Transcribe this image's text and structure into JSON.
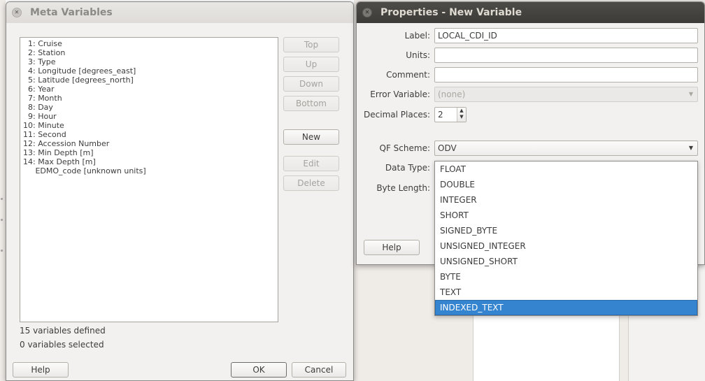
{
  "meta_dialog": {
    "title": "Meta Variables",
    "variables": [
      "  1: Cruise",
      "  2: Station",
      "  3: Type",
      "  4: Longitude [degrees_east]",
      "  5: Latitude [degrees_north]",
      "  6: Year",
      "  7: Month",
      "  8: Day",
      "  9: Hour",
      "10: Minute",
      "11: Second",
      "12: Accession Number",
      "13: Min Depth [m]",
      "14: Max Depth [m]",
      "     EDMO_code [unknown units]"
    ],
    "buttons": {
      "top": "Top",
      "up": "Up",
      "down": "Down",
      "bottom": "Bottom",
      "new": "New",
      "edit": "Edit",
      "delete": "Delete"
    },
    "status_defined": "15 variables defined",
    "status_selected": "0 variables selected",
    "help": "Help",
    "ok": "OK",
    "cancel": "Cancel"
  },
  "props_dialog": {
    "title": "Properties - New Variable",
    "label_label": "Label:",
    "label_value": "LOCAL_CDI_ID",
    "units_label": "Units:",
    "units_value": "",
    "comment_label": "Comment:",
    "comment_value": "",
    "error_label": "Error Variable:",
    "error_value": "(none)",
    "decimal_label": "Decimal Places:",
    "decimal_value": "2",
    "qf_label": "QF Scheme:",
    "qf_value": "ODV",
    "datatype_label": "Data Type:",
    "bytelength_label": "Byte Length:",
    "help": "Help",
    "datatype_options": [
      "FLOAT",
      "DOUBLE",
      "INTEGER",
      "SHORT",
      "SIGNED_BYTE",
      "UNSIGNED_INTEGER",
      "UNSIGNED_SHORT",
      "BYTE",
      "TEXT",
      "INDEXED_TEXT"
    ],
    "datatype_selected": "INDEXED_TEXT"
  },
  "icons": {
    "close": "close-icon",
    "dropdown": "chevron-down-icon",
    "spin_up": "spin-up-icon",
    "spin_down": "spin-down-icon"
  },
  "colors": {
    "active_titlebar": "#3c3b37",
    "selection": "#3584d0",
    "dialog_bg": "#f2f1f0"
  }
}
